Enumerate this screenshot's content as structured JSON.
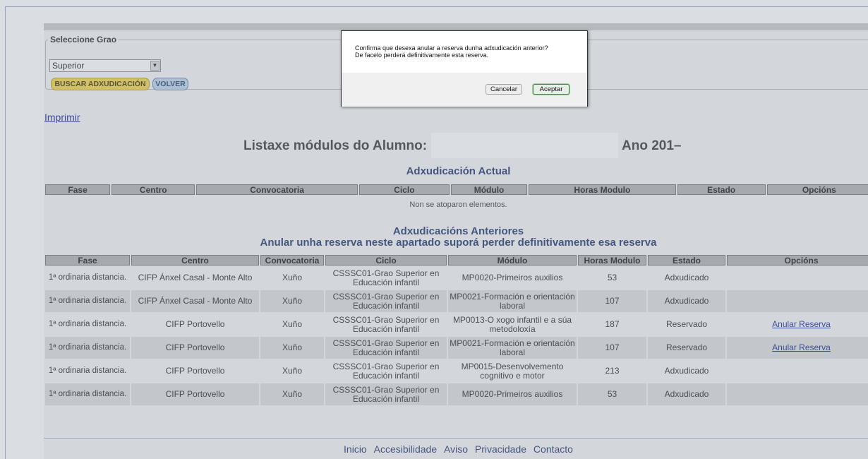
{
  "filter": {
    "legend": "Seleccione Grao",
    "select_value": "Superior",
    "buscar_label": "BUSCAR ADXUDICACIÓN",
    "volver_label": "VOLVER"
  },
  "imprimir": "Imprimir",
  "listaxe": {
    "prefix": "Listaxe módulos do Alumno:",
    "suffix": "Ano 201–"
  },
  "actual": {
    "title": "Adxudicación Actual",
    "headers": [
      "Fase",
      "Centro",
      "Convocatoria",
      "Ciclo",
      "Módulo",
      "Horas Modulo",
      "Estado",
      "Opcións"
    ],
    "empty_text": "Non se atoparon elementos."
  },
  "anteriores": {
    "title": "Adxudicacións Anteriores",
    "subtitle": "Anular unha reserva neste apartado suporá perder definitivamente esa reserva",
    "headers": [
      "Fase",
      "Centro",
      "Convocatoria",
      "Ciclo",
      "Módulo",
      "Horas Modulo",
      "Estado",
      "Opcións"
    ],
    "rows": [
      {
        "fase": "1ª ordinaria distancia.",
        "centro": "CIFP Ánxel Casal - Monte Alto",
        "convocatoria": "Xuño",
        "ciclo": "CSSSC01-Grao Superior en Educación infantil",
        "modulo": "MP0020-Primeiros auxilios",
        "horas": "53",
        "estado": "Adxudicado",
        "opcion": ""
      },
      {
        "fase": "1ª ordinaria distancia.",
        "centro": "CIFP Ánxel Casal - Monte Alto",
        "convocatoria": "Xuño",
        "ciclo": "CSSSC01-Grao Superior en Educación infantil",
        "modulo": "MP0021-Formación e orientación laboral",
        "horas": "107",
        "estado": "Adxudicado",
        "opcion": ""
      },
      {
        "fase": "1ª ordinaria distancia.",
        "centro": "CIFP Portovello",
        "convocatoria": "Xuño",
        "ciclo": "CSSSC01-Grao Superior en Educación infantil",
        "modulo": "MP0013-O xogo infantil e a súa metodoloxía",
        "horas": "187",
        "estado": "Reservado",
        "opcion": "Anular Reserva"
      },
      {
        "fase": "1ª ordinaria distancia.",
        "centro": "CIFP Portovello",
        "convocatoria": "Xuño",
        "ciclo": "CSSSC01-Grao Superior en Educación infantil",
        "modulo": "MP0021-Formación e orientación laboral",
        "horas": "107",
        "estado": "Reservado",
        "opcion": "Anular Reserva"
      },
      {
        "fase": "1ª ordinaria distancia.",
        "centro": "CIFP Portovello",
        "convocatoria": "Xuño",
        "ciclo": "CSSSC01-Grao Superior en Educación infantil",
        "modulo": "MP0015-Desenvolvemento cognitivo e motor",
        "horas": "213",
        "estado": "Adxudicado",
        "opcion": ""
      },
      {
        "fase": "1ª ordinaria distancia.",
        "centro": "CIFP Portovello",
        "convocatoria": "Xuño",
        "ciclo": "CSSSC01-Grao Superior en Educación infantil",
        "modulo": "MP0020-Primeiros auxilios",
        "horas": "53",
        "estado": "Adxudicado",
        "opcion": ""
      }
    ]
  },
  "footer": [
    "Inicio",
    "Accesibilidade",
    "Aviso",
    "Privacidade",
    "Contacto"
  ],
  "dialog": {
    "line1": "Confirma que desexa anular a reserva dunha adxudicación anterior?",
    "line2": "De facelo perderá definitivamente esta reserva.",
    "cancel": "Cancelar",
    "ok": "Aceptar"
  }
}
